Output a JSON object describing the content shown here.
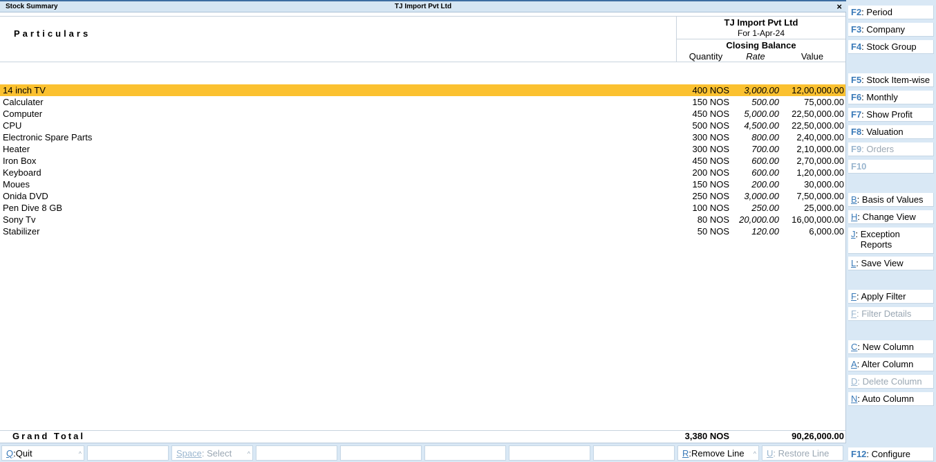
{
  "window": {
    "title_left": "Stock Summary",
    "title_center": "TJ Import Pvt Ltd",
    "close_glyph": "×"
  },
  "header": {
    "particulars": "Particulars",
    "company": "TJ Import Pvt Ltd",
    "period": "For 1-Apr-24",
    "closing_balance": "Closing Balance",
    "col_quantity": "Quantity",
    "col_rate": "Rate",
    "col_value": "Value"
  },
  "rows": [
    {
      "name": "14 inch TV",
      "qty": "400 NOS",
      "rate": "3,000.00",
      "value": "12,00,000.00"
    },
    {
      "name": "Calculater",
      "qty": "150 NOS",
      "rate": "500.00",
      "value": "75,000.00"
    },
    {
      "name": "Computer",
      "qty": "450 NOS",
      "rate": "5,000.00",
      "value": "22,50,000.00"
    },
    {
      "name": "CPU",
      "qty": "500 NOS",
      "rate": "4,500.00",
      "value": "22,50,000.00"
    },
    {
      "name": "Electronic Spare Parts",
      "qty": "300 NOS",
      "rate": "800.00",
      "value": "2,40,000.00"
    },
    {
      "name": "Heater",
      "qty": "300 NOS",
      "rate": "700.00",
      "value": "2,10,000.00"
    },
    {
      "name": "Iron Box",
      "qty": "450 NOS",
      "rate": "600.00",
      "value": "2,70,000.00"
    },
    {
      "name": "Keyboard",
      "qty": "200 NOS",
      "rate": "600.00",
      "value": "1,20,000.00"
    },
    {
      "name": "Moues",
      "qty": "150 NOS",
      "rate": "200.00",
      "value": "30,000.00"
    },
    {
      "name": "Onida DVD",
      "qty": "250 NOS",
      "rate": "3,000.00",
      "value": "7,50,000.00"
    },
    {
      "name": "Pen Dive 8 GB",
      "qty": "100 NOS",
      "rate": "250.00",
      "value": "25,000.00"
    },
    {
      "name": "Sony Tv",
      "qty": "80 NOS",
      "rate": "20,000.00",
      "value": "16,00,000.00"
    },
    {
      "name": "Stabilizer",
      "qty": "50 NOS",
      "rate": "120.00",
      "value": "6,000.00"
    }
  ],
  "total": {
    "label": "Grand Total",
    "qty": "3,380 NOS",
    "value": "90,26,000.00"
  },
  "bottom": {
    "quit_key": "Q",
    "quit_label": "Quit",
    "select_key": "Space",
    "select_label": "Select",
    "remove_key": "R",
    "remove_label": "Remove Line",
    "restore_key": "U",
    "restore_label": "Restore Line",
    "caret": "^"
  },
  "right_panel": {
    "period": {
      "key": "F2",
      "label": "Period"
    },
    "company": {
      "key": "F3",
      "label": "Company"
    },
    "stock_group": {
      "key": "F4",
      "label": "Stock Group"
    },
    "stock_item_wise": {
      "key": "F5",
      "label": "Stock Item-wise"
    },
    "monthly": {
      "key": "F6",
      "label": "Monthly"
    },
    "show_profit": {
      "key": "F7",
      "label": "Show Profit"
    },
    "valuation": {
      "key": "F8",
      "label": "Valuation"
    },
    "orders": {
      "key": "F9",
      "label": "Orders"
    },
    "f10": {
      "key": "F10"
    },
    "basis_of_values": {
      "key": "B",
      "label": "Basis of Values"
    },
    "change_view": {
      "key": "H",
      "label": "Change View"
    },
    "exception_reports": {
      "key": "J",
      "label1": "Exception",
      "label2": "Reports"
    },
    "save_view": {
      "key": "L",
      "label": "Save View"
    },
    "apply_filter": {
      "key": "F",
      "label": "Apply Filter"
    },
    "filter_details": {
      "key": "F",
      "label": "Filter Details"
    },
    "new_column": {
      "key": "C",
      "label": "New Column"
    },
    "alter_column": {
      "key": "A",
      "label": "Alter Column"
    },
    "delete_column": {
      "key": "D",
      "label": "Delete Column"
    },
    "auto_column": {
      "key": "N",
      "label": "Auto Column"
    },
    "configure": {
      "key": "F12",
      "label": "Configure"
    }
  },
  "colors": {
    "selected_row": "#fbc130",
    "panel_bg": "#d9e8f5",
    "key_blue": "#3a7ab8"
  }
}
